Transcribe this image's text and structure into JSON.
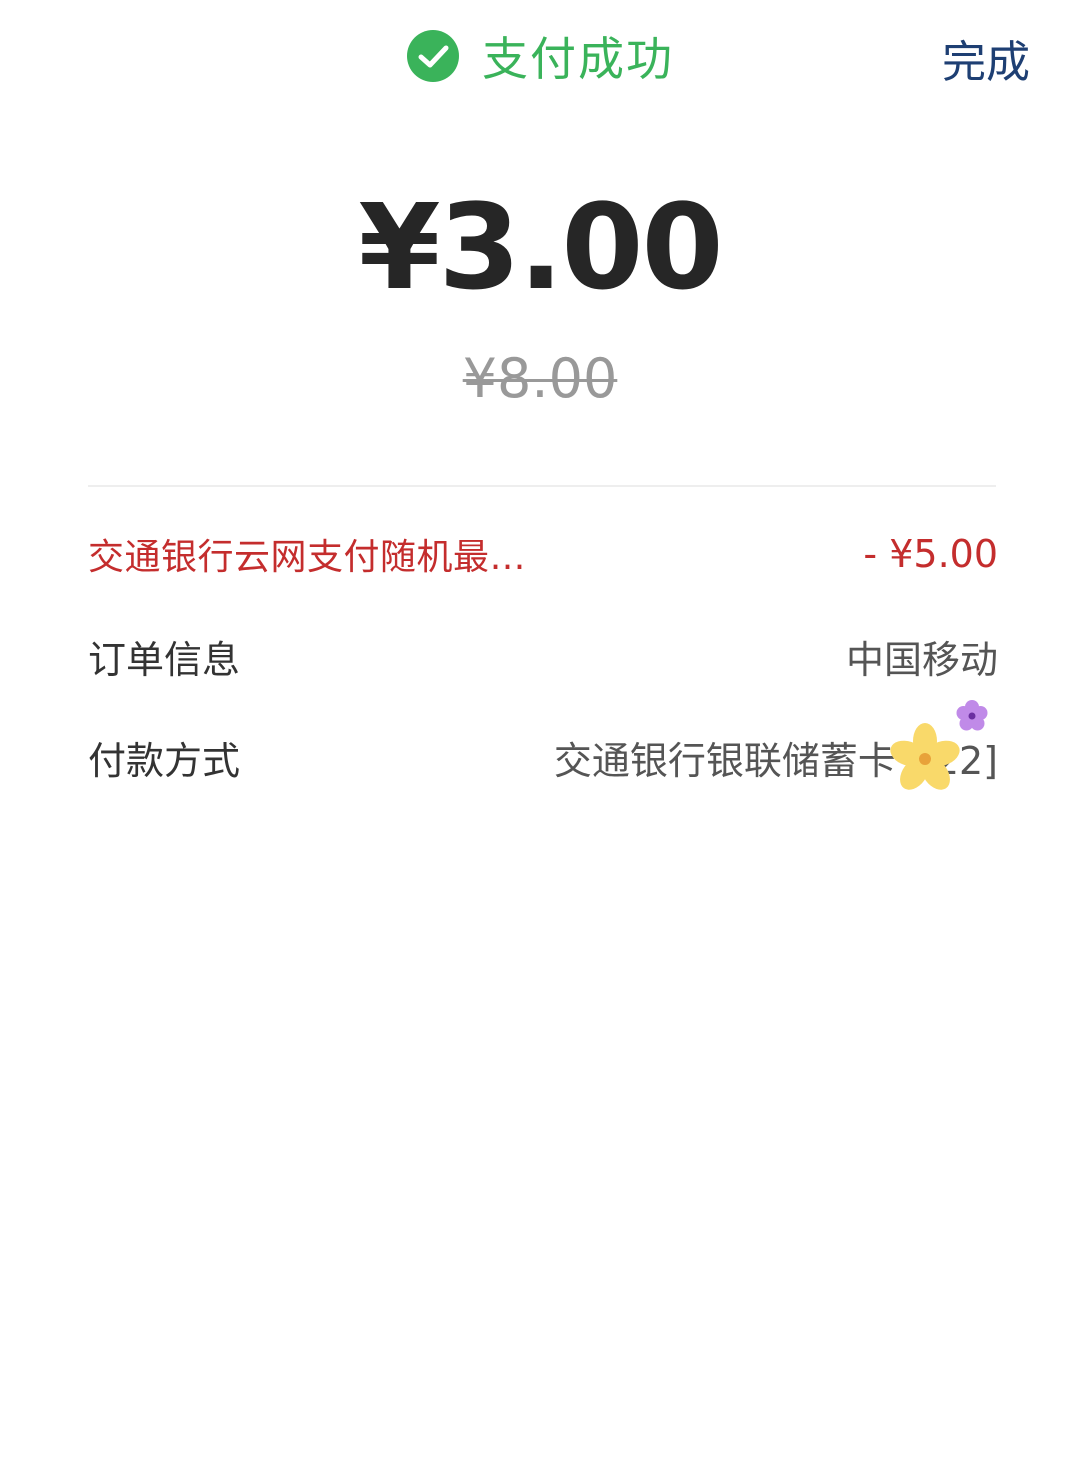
{
  "header": {
    "status_title": "支付成功",
    "status_icon": "check-circle-icon",
    "status_color": "#3ab35a",
    "done_label": "完成",
    "done_color": "#1e3f73"
  },
  "payment": {
    "amount": "¥3.00",
    "original_amount": "¥8.00"
  },
  "details": {
    "discount": {
      "label": "交通银行云网支付随机最…",
      "value": "- ¥5.00",
      "color": "#c42d2d"
    },
    "order_info": {
      "label": "订单信息",
      "value": "中国移动"
    },
    "payment_method": {
      "label": "付款方式",
      "value": "交通银行银联储蓄卡 [  22]"
    }
  },
  "stickers": [
    "yellow-flower-sticker",
    "purple-flower-sticker"
  ]
}
